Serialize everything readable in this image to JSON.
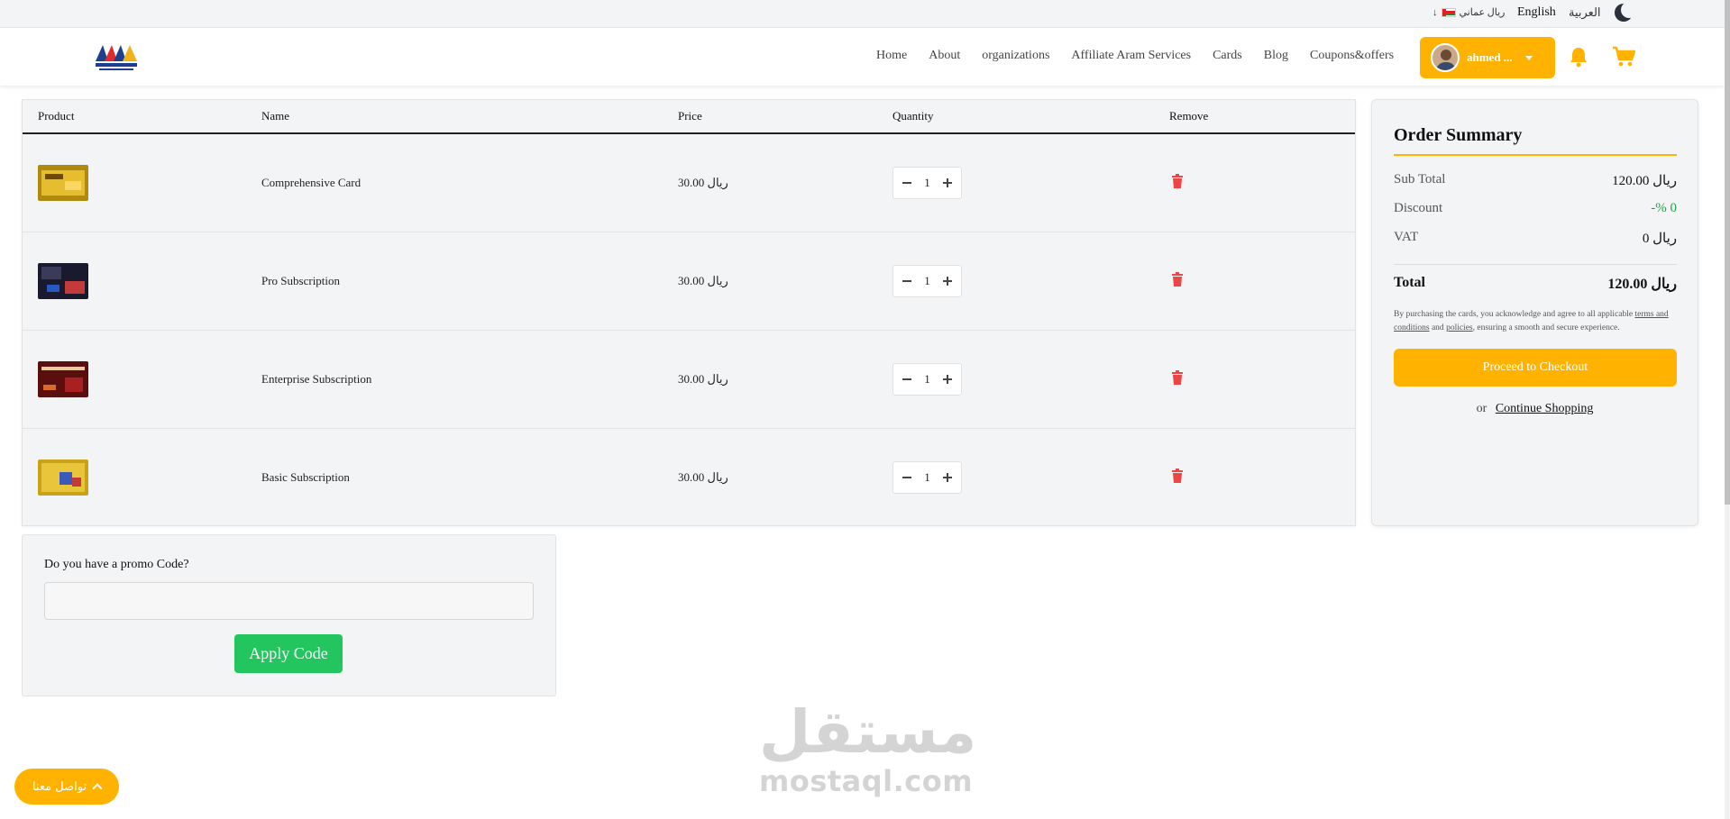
{
  "topbar": {
    "currency": "ريال عماني",
    "lang_en": "English",
    "lang_ar": "العربية"
  },
  "nav": {
    "items": [
      "Home",
      "About",
      "organizations",
      "Affiliate Aram Services",
      "Cards",
      "Blog",
      "Coupons&offers"
    ]
  },
  "user": {
    "name": "ahmed ..."
  },
  "table": {
    "headers": [
      "Product",
      "Name",
      "Price",
      "Quantity",
      "Remove"
    ],
    "rows": [
      {
        "name": "Comprehensive Card",
        "price": "30.00 ريال",
        "qty": "1"
      },
      {
        "name": "Pro Subscription",
        "price": "30.00 ريال",
        "qty": "1"
      },
      {
        "name": "Enterprise Subscription",
        "price": "30.00 ريال",
        "qty": "1"
      },
      {
        "name": "Basic Subscription",
        "price": "30.00 ريال",
        "qty": "1"
      }
    ]
  },
  "promo": {
    "question": "Do you have a promo Code?",
    "input_value": "",
    "apply_label": "Apply Code"
  },
  "summary": {
    "title": "Order Summary",
    "subtotal_label": "Sub Total",
    "subtotal_value": "120.00 ريال",
    "discount_label": "Discount",
    "discount_value": "-% 0",
    "vat_label": "VAT",
    "vat_value": "0 ريال",
    "total_label": "Total",
    "total_value": "120.00 ريال",
    "terms_prefix": "By purchasing the cards, you acknowledge and agree to all applicable",
    "terms_link": "terms and conditions",
    "terms_and": "and",
    "policies_link": "policies",
    "terms_suffix": ", ensuring a smooth and secure experience.",
    "checkout_label": "Proceed to Checkout",
    "or_text": "or",
    "continue_label": "Continue Shopping"
  },
  "watermark": {
    "arabic": "مستقل",
    "latin": "mostaql.com"
  },
  "contact": {
    "label": "تواصل معنا"
  },
  "colors": {
    "accent": "#ffb300",
    "green": "#22c55e",
    "danger": "#ef4444"
  }
}
